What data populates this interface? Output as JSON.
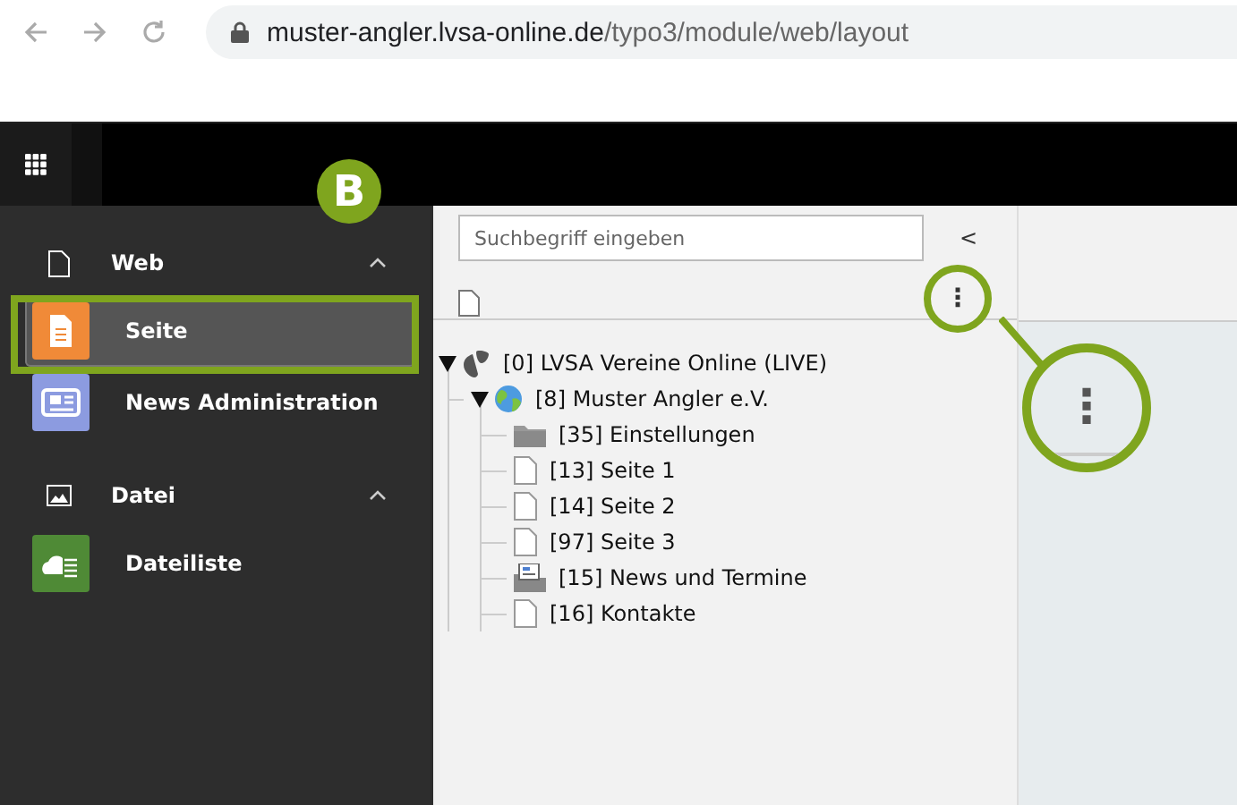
{
  "browser": {
    "url_host": "muster-angler.lvsa-online.de",
    "url_path": "/typo3/module/web/layout"
  },
  "annotation": {
    "badge": "B"
  },
  "sidebar": {
    "groups": [
      {
        "label": "Web",
        "kind": "web",
        "expanded": true,
        "items": [
          {
            "label": "Seite",
            "kind": "page",
            "selected": true
          },
          {
            "label": "News Administration",
            "kind": "news",
            "selected": false
          }
        ]
      },
      {
        "label": "Datei",
        "kind": "file",
        "expanded": true,
        "items": [
          {
            "label": "Dateiliste",
            "kind": "filelist",
            "selected": false
          }
        ]
      }
    ]
  },
  "page_tree": {
    "search": {
      "placeholder": "Suchbegriff eingeben"
    },
    "collapse_button": "<",
    "menu_button": "⋮",
    "nodes": [
      {
        "label": "[0] LVSA Vereine Online (LIVE)",
        "kind": "root",
        "expanded": true,
        "children": [
          {
            "label": "[8] Muster Angler e.V.",
            "kind": "site",
            "expanded": true,
            "children": [
              {
                "label": "[35] Einstellungen",
                "kind": "folder"
              },
              {
                "label": "[13] Seite 1",
                "kind": "page"
              },
              {
                "label": "[14] Seite 2",
                "kind": "page"
              },
              {
                "label": "[97] Seite 3",
                "kind": "page"
              },
              {
                "label": "[15] News und Termine",
                "kind": "news"
              },
              {
                "label": "[16] Kontakte",
                "kind": "page"
              }
            ]
          }
        ]
      }
    ]
  },
  "zoom_callout": {
    "menu_button": "⋮"
  }
}
